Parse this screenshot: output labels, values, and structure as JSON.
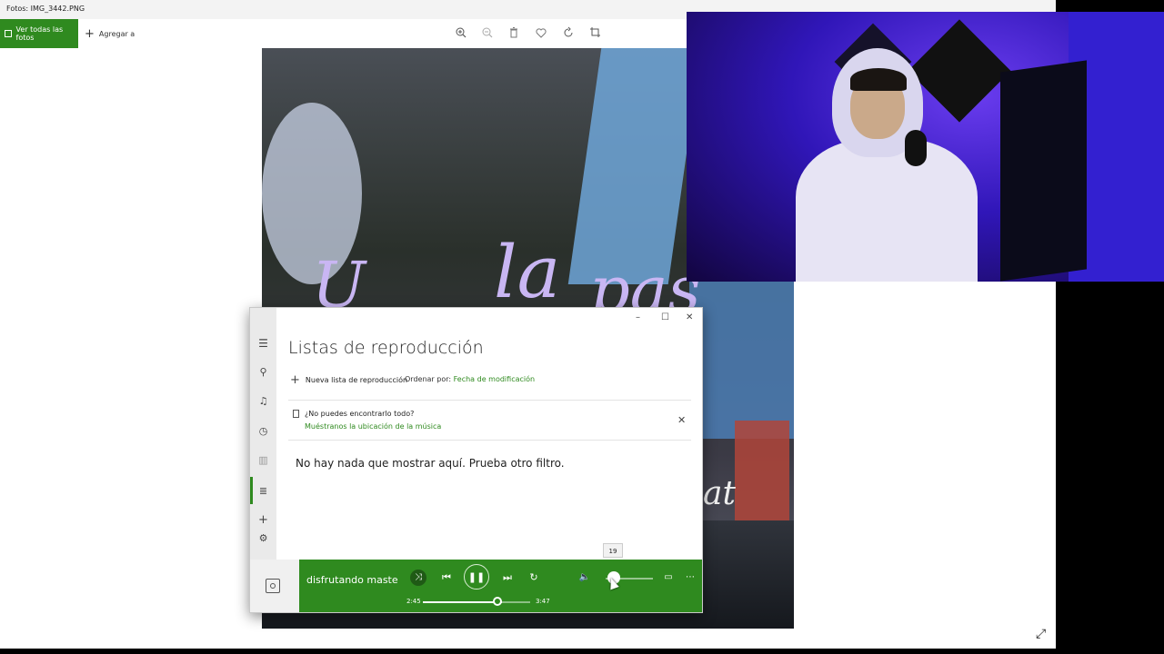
{
  "photos_window": {
    "title": "Fotos: IMG_3442.PNG",
    "toolbar": {
      "view_all_label": "Ver todas las fotos",
      "add_to_label": "Agregar a",
      "icons": [
        "zoom-in-icon",
        "zoom-out-icon",
        "delete-icon",
        "heart-icon",
        "rotate-icon",
        "crop-icon"
      ]
    }
  },
  "music_window": {
    "title": "Listas de reproducción",
    "new_playlist_label": "Nueva lista de reproducción",
    "sort_label": "Ordenar por:",
    "sort_value": "Fecha de modificación",
    "notice_question": "¿No puedes encontrarlo todo?",
    "notice_link": "Muéstranos la ubicación de la música",
    "empty_message": "No hay nada que mostrar aquí. Prueba otro filtro.",
    "player": {
      "song_title": "disfrutando maste",
      "current_time": "2:45",
      "total_time": "3:47",
      "progress": 0.74,
      "volume": 19,
      "volume_tooltip": "19"
    }
  },
  "colors": {
    "accent_green": "#2f8a1f"
  }
}
